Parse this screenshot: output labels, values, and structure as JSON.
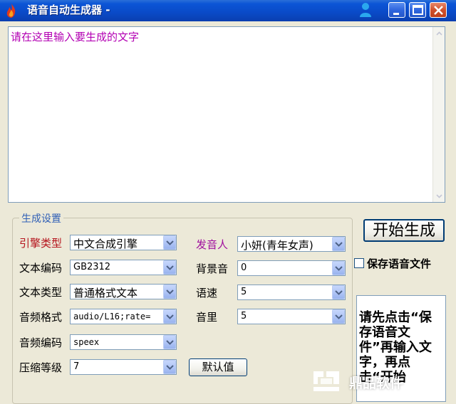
{
  "window": {
    "title": "语音自动生成器 -"
  },
  "text_area": {
    "content": "请在这里输入要生成的文字"
  },
  "settings": {
    "group_title": "生成设置",
    "engine_type": {
      "label": "引擎类型",
      "value": "中文合成引擎"
    },
    "text_encoding": {
      "label": "文本编码",
      "value": "GB2312"
    },
    "text_type": {
      "label": "文本类型",
      "value": "普通格式文本"
    },
    "audio_format": {
      "label": "音频格式",
      "value": "audio/L16;rate="
    },
    "audio_codec": {
      "label": "音频编码",
      "value": "speex"
    },
    "compression_level": {
      "label": "压缩等级",
      "value": "7"
    },
    "speaker": {
      "label": "发音人",
      "value": "小妍(青年女声)"
    },
    "background_sound": {
      "label": "背景音",
      "value": "0"
    },
    "speed": {
      "label": "语速",
      "value": "5"
    },
    "volume": {
      "label": "音里",
      "value": "5"
    },
    "default_button": "默认值"
  },
  "actions": {
    "start_button": "开始生成",
    "save_checkbox_label": "保存语音文件",
    "save_checked": false,
    "notice_text": "请先点击“保存语音文件”再输入文字，再点击“开始"
  },
  "watermark": {
    "text": "鼎品软件"
  },
  "colors": {
    "titlebar": "#0a4ac7",
    "prompt_text": "#b300b3",
    "engine_label": "#b5121b",
    "speaker_label": "#a0109e",
    "group_title": "#2f5fb6"
  },
  "icons": {
    "app": "fire-icon",
    "titlebar_extra": "person-icon",
    "minimize": "minimize-icon",
    "maximize": "maximize-icon",
    "close": "close-icon",
    "dropdown": "chevron-down-icon",
    "watermark": "logo-icon"
  }
}
